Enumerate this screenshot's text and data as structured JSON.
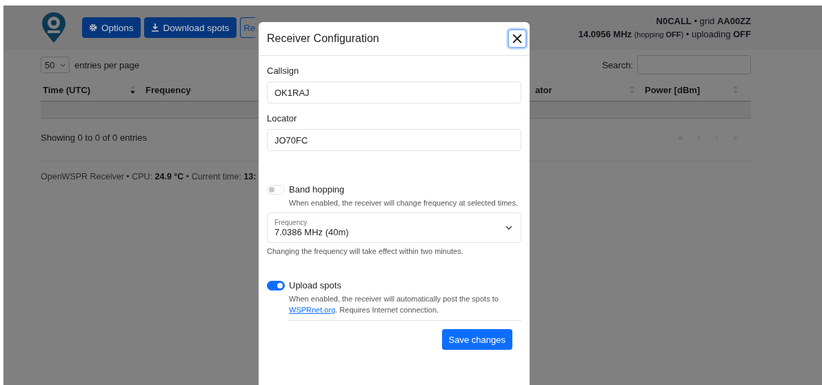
{
  "header": {
    "buttons": [
      {
        "label": "Options",
        "kind": "options"
      },
      {
        "label": "Download spots",
        "kind": "download"
      },
      {
        "label": "Re",
        "kind": "outline"
      }
    ],
    "station": "**N0CALL** • grid **AA00ZZ**",
    "frequency": "14.0956 MHz",
    "hopping": "(hopping **OFF**)",
    "uploading": "• uploading **OFF**"
  },
  "table": {
    "page_size": "50",
    "page_size_label": "entries per page",
    "search_label": "Search:",
    "columns": [
      {
        "label": "Time (UTC)",
        "sortable": true,
        "sorted": true
      },
      {
        "label": "Frequency",
        "sortable": false
      },
      {
        "label": "ator",
        "sortable": true,
        "sorted": false
      },
      {
        "label": "Power [dBm]",
        "sortable": true,
        "sorted": false
      }
    ],
    "info": "Showing 0 to 0 of 0 entries",
    "pagination": [
      "«",
      "‹",
      "›",
      "»"
    ]
  },
  "footer": "OpenWSPR Receiver • CPU: **24.9 °C** • Current time: **13:**",
  "dialog": {
    "title": "Receiver Configuration",
    "fields": [
      {
        "label": "Callsign",
        "value": "OK1RAJ"
      },
      {
        "label": "Locator",
        "value": "JO70FC"
      }
    ],
    "band_hopping": {
      "label": "Band hopping",
      "on": false,
      "help": "When enabled, the receiver will change frequency at selected times."
    },
    "frequency": {
      "label": "Frequency",
      "value": "7.0386 MHz (40m)",
      "help": "Changing the frequency will take effect within two minutes."
    },
    "upload": {
      "label": "Upload spots",
      "on": true,
      "help_before": "When enabled, the receiver will automatically post the spots to ",
      "link": "WSPRnet.org",
      "help_after": ". Requires Internet connection."
    },
    "save": "Save changes"
  }
}
